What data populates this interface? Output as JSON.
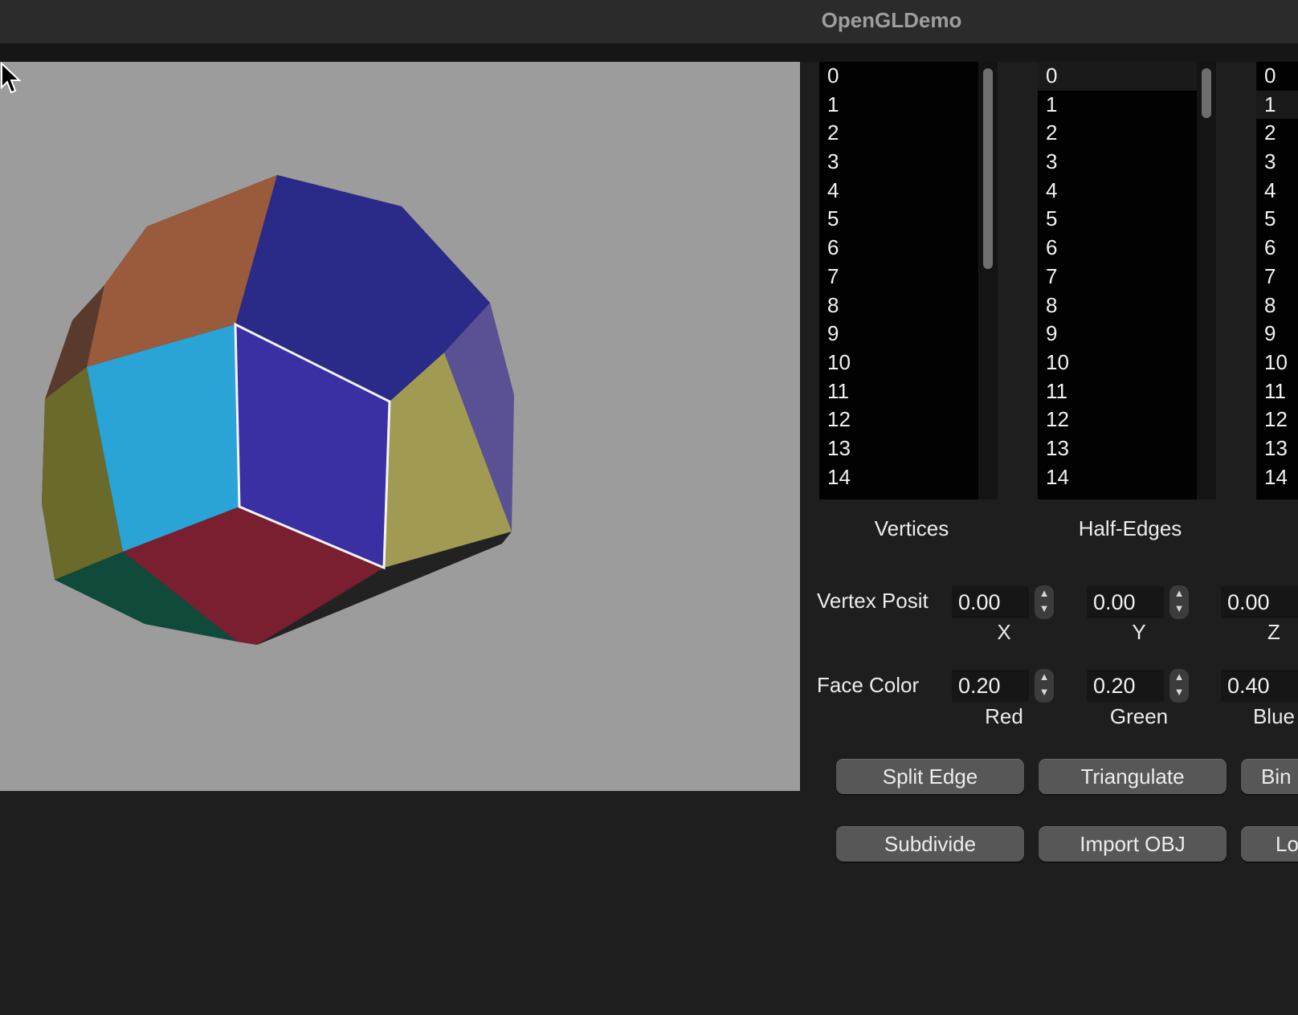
{
  "window": {
    "title": "OpenGLDemo"
  },
  "lists": {
    "vertices": {
      "items": [
        "0",
        "1",
        "2",
        "3",
        "4",
        "5",
        "6",
        "7",
        "8",
        "9",
        "10",
        "11",
        "12",
        "13",
        "14"
      ],
      "caption": "Vertices"
    },
    "half_edges": {
      "items": [
        "0",
        "1",
        "2",
        "3",
        "4",
        "5",
        "6",
        "7",
        "8",
        "9",
        "10",
        "11",
        "12",
        "13",
        "14"
      ],
      "caption": "Half-Edges"
    },
    "faces": {
      "items": [
        "0",
        "1",
        "2",
        "3",
        "4",
        "5",
        "6",
        "7",
        "8",
        "9",
        "10",
        "11",
        "12",
        "13",
        "14"
      ],
      "selected": "1"
    }
  },
  "vertex_position": {
    "label": "Vertex Posit",
    "x": {
      "value": "0.00",
      "label": "X"
    },
    "y": {
      "value": "0.00",
      "label": "Y"
    },
    "z": {
      "value": "0.00",
      "label": "Z"
    }
  },
  "face_color": {
    "label": "Face Color",
    "red": {
      "value": "0.20",
      "label": "Red"
    },
    "green": {
      "value": "0.20",
      "label": "Green"
    },
    "blue": {
      "value": "0.40",
      "label": "Blue"
    }
  },
  "buttons": {
    "split_edge": "Split Edge",
    "triangulate": "Triangulate",
    "bin": "Bin",
    "subdivide": "Subdivide",
    "import_obj": "Import OBJ",
    "lo": "Lo"
  },
  "colors": {
    "viewport_bg": "#9c9c9c",
    "panel_bg": "#1e1e1e",
    "face_red": "#9a5a3c",
    "face_navy": "#2a2a88",
    "face_cyan": "#2aa3d6",
    "face_blue": "#3a2fa3",
    "face_olive": "#a09a52",
    "face_lavender": "#5a5194",
    "face_crimson": "#7a1f30",
    "face_green": "#0f4a3a",
    "selection_outline": "#f4f4f4"
  }
}
